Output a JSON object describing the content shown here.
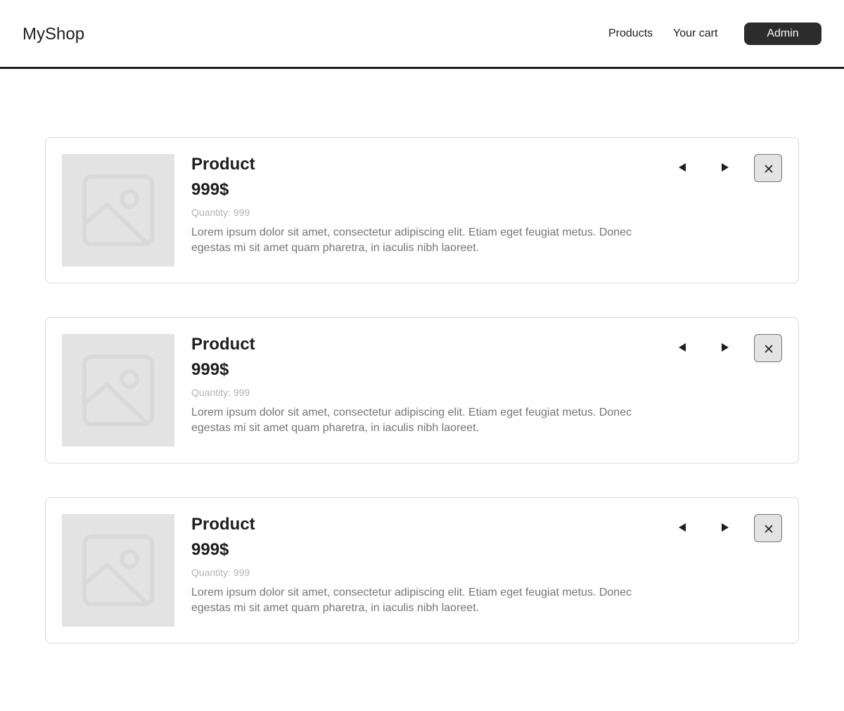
{
  "header": {
    "brand": "MyShop",
    "nav": {
      "products": "Products",
      "cart": "Your cart",
      "admin": "Admin"
    }
  },
  "cart_items": [
    {
      "name": "Product",
      "price": "999$",
      "quantity_label": "Quantity:",
      "quantity": "999",
      "description": "Lorem ipsum dolor sit amet, consectetur adipiscing elit. Etiam eget feugiat metus. Donec egestas mi sit amet quam pharetra, in iaculis nibh laoreet.",
      "image_icon": "image-placeholder-icon",
      "controls": [
        "arrow-left-icon",
        "arrow-right-icon",
        "close-icon"
      ]
    },
    {
      "name": "Product",
      "price": "999$",
      "quantity_label": "Quantity:",
      "quantity": "999",
      "description": "Lorem ipsum dolor sit amet, consectetur adipiscing elit. Etiam eget feugiat metus. Donec egestas mi sit amet quam pharetra, in iaculis nibh laoreet.",
      "image_icon": "image-placeholder-icon",
      "controls": [
        "arrow-left-icon",
        "arrow-right-icon",
        "close-icon"
      ]
    },
    {
      "name": "Product",
      "price": "999$",
      "quantity_label": "Quantity:",
      "quantity": "999",
      "description": "Lorem ipsum dolor sit amet, consectetur adipiscing elit. Etiam eget feugiat metus. Donec egestas mi sit amet quam pharetra, in iaculis nibh laoreet.",
      "image_icon": "image-placeholder-icon",
      "controls": [
        "arrow-left-icon",
        "arrow-right-icon",
        "close-icon"
      ]
    }
  ],
  "colors": {
    "text_primary": "#1e1e1e",
    "text_secondary": "#757575",
    "text_muted": "#b3b3b3",
    "button_dark": "#2c2c2c",
    "placeholder_bg": "#e3e3e3",
    "card_border": "#d9d9d9"
  }
}
